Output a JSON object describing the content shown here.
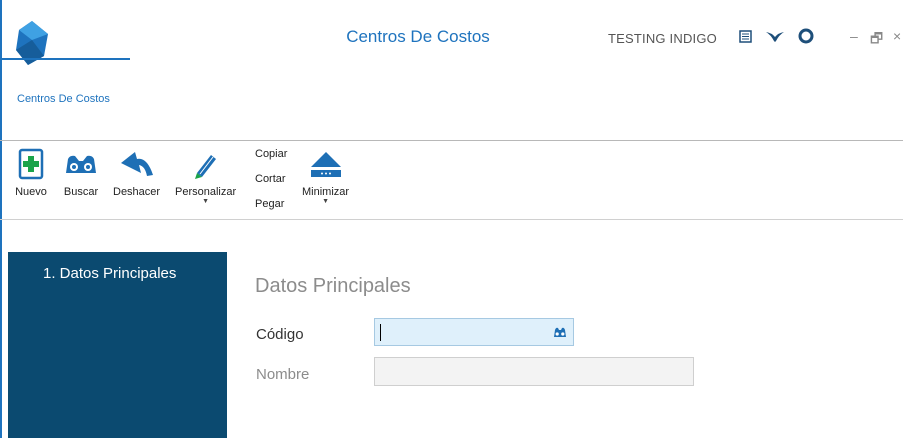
{
  "window": {
    "title": "Centros De Costos",
    "user": "TESTING INDIGO",
    "controls": {
      "minimize": "–",
      "restore": "🗗",
      "close": "×"
    }
  },
  "tabs": [
    {
      "label": "Centros De Costos",
      "active": true
    }
  ],
  "toolbar": {
    "nuevo": "Nuevo",
    "buscar": "Buscar",
    "deshacer": "Deshacer",
    "personalizar": "Personalizar",
    "copiar": "Copiar",
    "cortar": "Cortar",
    "pegar": "Pegar",
    "minimizar": "Minimizar"
  },
  "sidebar": {
    "items": [
      {
        "label": "1. Datos Principales"
      }
    ]
  },
  "form": {
    "section_title": "Datos Principales",
    "codigo_label": "Código",
    "codigo_value": "",
    "nombre_label": "Nombre",
    "nombre_value": ""
  },
  "colors": {
    "accent": "#1e73be",
    "sidebar_bg": "#0b4a70",
    "input_active_bg": "#dff0fb",
    "new_icon_green": "#1aa34a",
    "icon_blue": "#1e6fb5"
  },
  "icons": [
    "app-logo-icon",
    "notes-icon",
    "bird-icon",
    "gear-icon",
    "new-doc-icon",
    "binoculars-icon",
    "undo-icon",
    "pencil-icon",
    "eject-icon"
  ]
}
